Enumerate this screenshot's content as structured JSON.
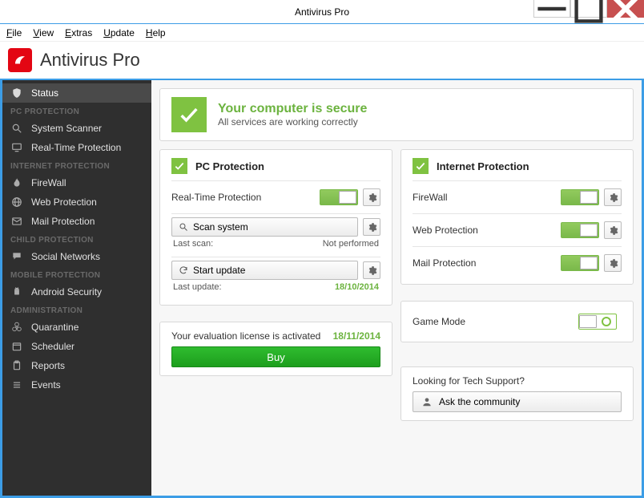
{
  "window": {
    "title": "Antivirus Pro"
  },
  "menu": {
    "file": "File",
    "view": "View",
    "extras": "Extras",
    "update": "Update",
    "help": "Help"
  },
  "app": {
    "title": "Antivirus Pro"
  },
  "sidebar": {
    "status": "Status",
    "sections": {
      "pc": {
        "header": "PC PROTECTION",
        "items": [
          "System Scanner",
          "Real-Time Protection"
        ]
      },
      "internet": {
        "header": "INTERNET PROTECTION",
        "items": [
          "FireWall",
          "Web Protection",
          "Mail Protection"
        ]
      },
      "child": {
        "header": "CHILD PROTECTION",
        "items": [
          "Social Networks"
        ]
      },
      "mobile": {
        "header": "MOBILE PROTECTION",
        "items": [
          "Android Security"
        ]
      },
      "admin": {
        "header": "ADMINISTRATION",
        "items": [
          "Quarantine",
          "Scheduler",
          "Reports",
          "Events"
        ]
      }
    }
  },
  "status": {
    "title": "Your computer is secure",
    "subtitle": "All services are working correctly"
  },
  "pc_protection": {
    "title": "PC Protection",
    "realtime": {
      "label": "Real-Time Protection",
      "on": true
    },
    "scan": {
      "button": "Scan system",
      "last_label": "Last scan:",
      "last_value": "Not performed"
    },
    "update": {
      "button": "Start update",
      "last_label": "Last update:",
      "last_value": "18/10/2014"
    }
  },
  "internet_protection": {
    "title": "Internet Protection",
    "firewall": {
      "label": "FireWall",
      "on": true
    },
    "web": {
      "label": "Web Protection",
      "on": true
    },
    "mail": {
      "label": "Mail Protection",
      "on": true
    }
  },
  "license": {
    "text": "Your evaluation license is activated",
    "date": "18/11/2014",
    "buy": "Buy"
  },
  "gamemode": {
    "label": "Game Mode",
    "on": false
  },
  "support": {
    "label": "Looking for Tech Support?",
    "button": "Ask the community"
  }
}
